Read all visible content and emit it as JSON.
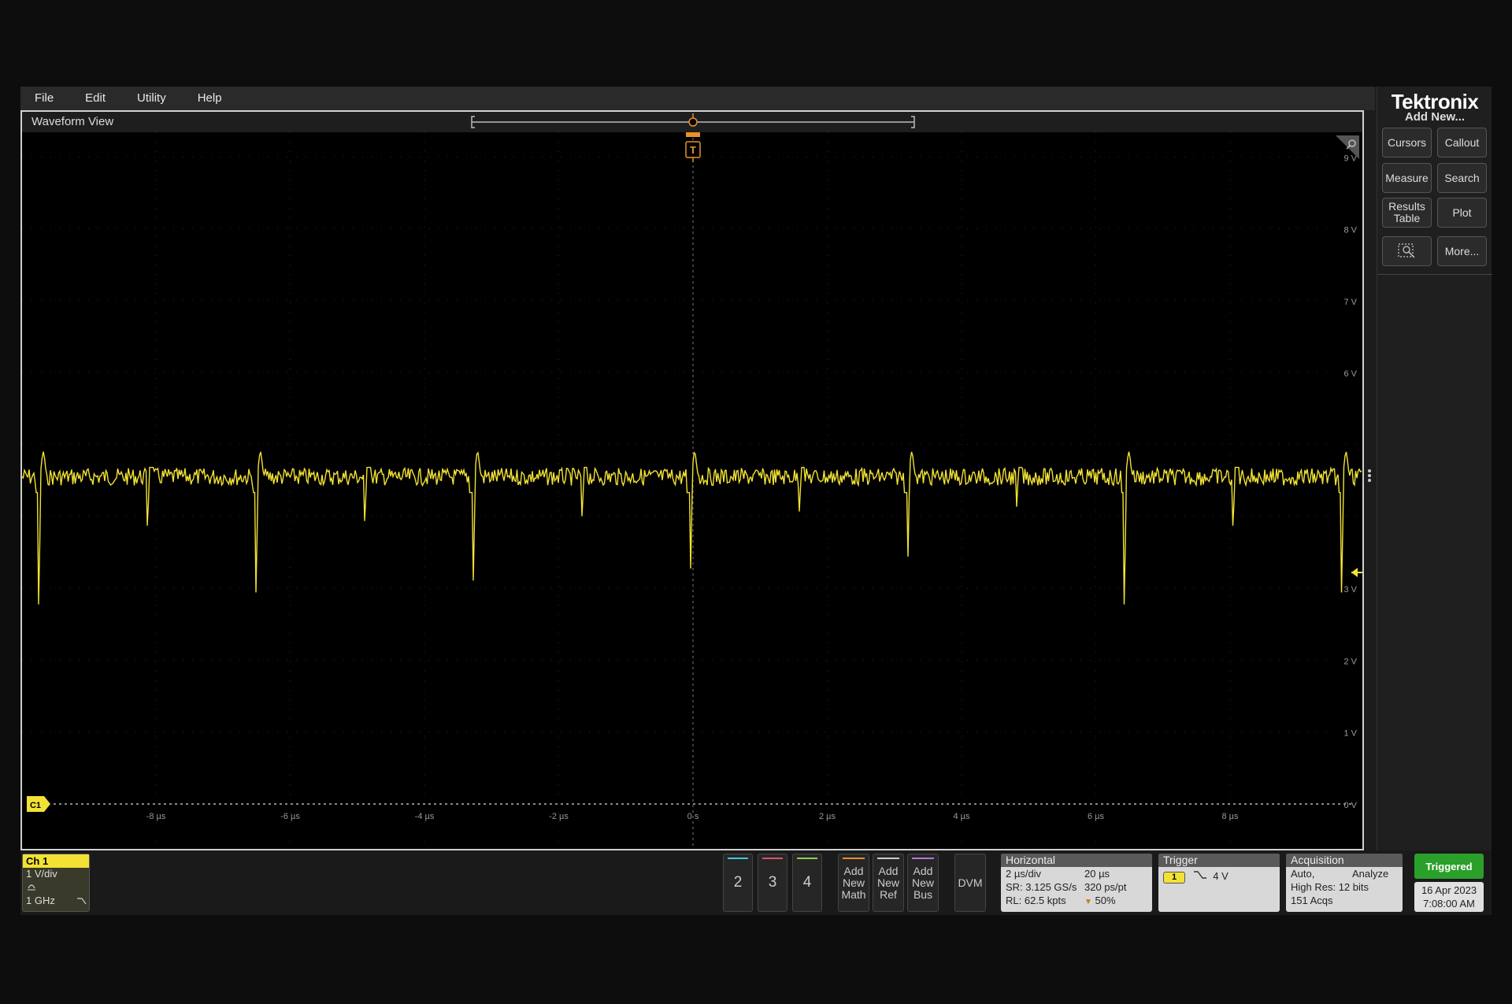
{
  "menubar": {
    "items": [
      "File",
      "Edit",
      "Utility",
      "Help"
    ]
  },
  "waveform_view": {
    "title": "Waveform View",
    "y_tick_labels": [
      "9 V",
      "8 V",
      "7 V",
      "6 V",
      "3 V",
      "2 V",
      "1 V",
      "0 V"
    ],
    "x_tick_labels": [
      "-8 µs",
      "-6 µs",
      "-4 µs",
      "-2 µs",
      "0 s",
      "2 µs",
      "4 µs",
      "6 µs",
      "8 µs"
    ],
    "channel_marker": "C1",
    "trigger_marker": "T",
    "trace_color": "#f2e234"
  },
  "right_panel": {
    "brand": "Tektronix",
    "add_new": "Add New...",
    "buttons": {
      "cursors": "Cursors",
      "callout": "Callout",
      "measure": "Measure",
      "search": "Search",
      "results_table_1": "Results",
      "results_table_2": "Table",
      "plot": "Plot",
      "more": "More..."
    }
  },
  "bottom": {
    "ch1": {
      "title": "Ch 1",
      "scale": "1 V/div",
      "bandwidth": "1 GHz",
      "color": "#f2e234"
    },
    "channel_buttons": [
      {
        "label": "2",
        "color": "#3ec9d6"
      },
      {
        "label": "3",
        "color": "#e0506a"
      },
      {
        "label": "4",
        "color": "#8fd14f"
      }
    ],
    "add_math": [
      "Add",
      "New",
      "Math"
    ],
    "add_ref": [
      "Add",
      "New",
      "Ref"
    ],
    "add_bus": [
      "Add",
      "New",
      "Bus"
    ],
    "add_colors": {
      "math": "#e8912a",
      "ref": "#cccccc",
      "bus": "#b07ad6"
    },
    "dvm": "DVM",
    "horizontal": {
      "title": "Horizontal",
      "scale": "2 µs/div",
      "duration": "20 µs",
      "sample_rate": "SR: 3.125 GS/s",
      "resolution": "320 ps/pt",
      "record_length": "RL: 62.5 kpts",
      "position": "50%"
    },
    "trigger": {
      "title": "Trigger",
      "source": "1",
      "level": "4 V"
    },
    "acquisition": {
      "title": "Acquisition",
      "mode": "Auto,",
      "analyze": "Analyze",
      "high_res": "High Res: 12 bits",
      "acqs": "151 Acqs"
    },
    "status": "Triggered",
    "date": "16 Apr 2023",
    "time": "7:08:00 AM"
  }
}
